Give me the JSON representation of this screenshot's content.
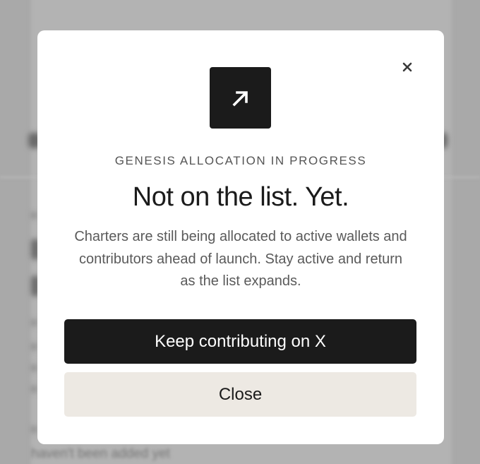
{
  "background": {
    "partial_text": "haven't been added yet"
  },
  "modal": {
    "close_icon": "close-icon",
    "badge_icon": "arrow-up-right-icon",
    "eyebrow": "GENESIS ALLOCATION IN PROGRESS",
    "title": "Not on the list. Yet.",
    "description": "Charters are still being allocated to active wallets and contributors ahead of launch. Stay active and return as the list expands.",
    "primary_button": "Keep contributing on X",
    "secondary_button": "Close"
  },
  "colors": {
    "backdrop": "#a9a9a9",
    "modal_bg": "#ffffff",
    "primary_button_bg": "#1b1b1b",
    "secondary_button_bg": "#ede9e3",
    "text_dark": "#1b1b1b",
    "text_muted": "#5a5a5a"
  }
}
